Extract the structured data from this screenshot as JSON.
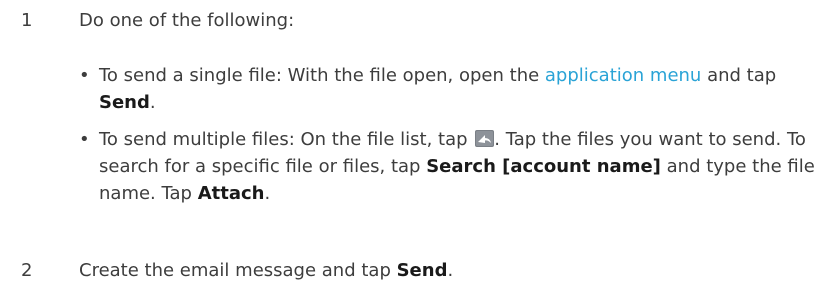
{
  "steps": [
    {
      "number": "1",
      "text": "Do one of the following:"
    },
    {
      "number": "2",
      "text_before": "Create the email message and tap ",
      "bold": "Send",
      "text_after": "."
    }
  ],
  "bullets": [
    {
      "marker": "•",
      "lead": "To send a single file: With the file open, open the ",
      "link": "application menu",
      "mid": " and tap ",
      "bold": "Send",
      "end": "."
    },
    {
      "marker": "•",
      "lead": "To send multiple files: On the file list, tap ",
      "icon_name": "send-share-icon",
      "text1": ". Tap the files you want to send. To search for a specific file or files, tap ",
      "bold1": "Search [account name]",
      "text2": " and type the file name. Tap ",
      "bold2": "Attach",
      "end": "."
    }
  ]
}
